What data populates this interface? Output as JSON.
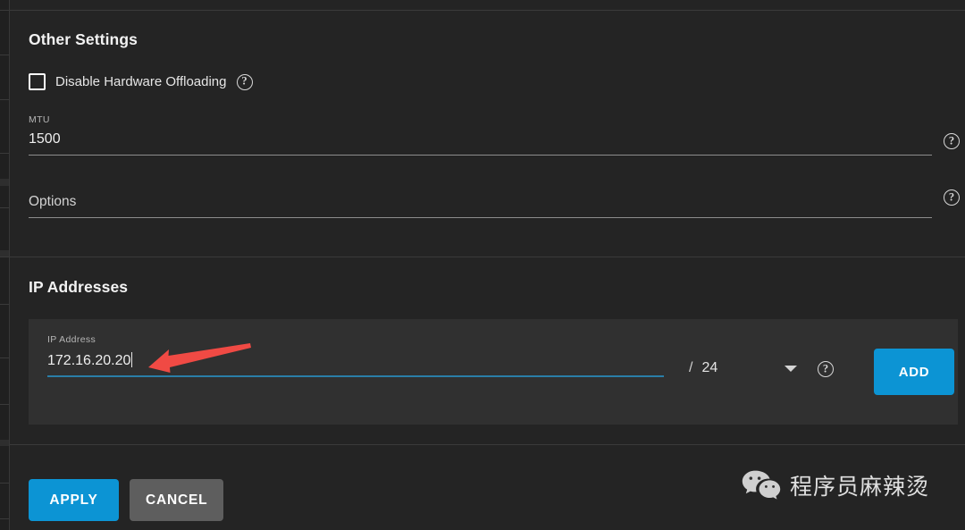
{
  "colors": {
    "page_bg": "#242424",
    "card_bg": "#303030",
    "accent_blue": "#0c94d4",
    "focus_underline": "#2a7ea8",
    "annotation_red": "#f04a44",
    "text_primary": "#eeeeee",
    "text_muted": "#b6b6b6",
    "divider": "#3a3a3a",
    "cancel_gray": "#5e5e5e"
  },
  "other_settings": {
    "title": "Other Settings",
    "checkbox": {
      "label": "Disable Hardware Offloading",
      "checked": false,
      "help_icon": "help-circle-icon"
    },
    "mtu": {
      "label": "MTU",
      "value": "1500",
      "help_icon": "help-circle-icon"
    },
    "options": {
      "label": "",
      "value": "",
      "placeholder": "Options",
      "help_icon": "help-circle-icon"
    }
  },
  "ip_addresses": {
    "title": "IP Addresses",
    "row": {
      "ip_label": "IP Address",
      "ip_value": "172.16.20.20",
      "ip_focused": true,
      "separator": "/",
      "prefix_value": "24",
      "prefix_caret_icon": "chevron-down-icon",
      "help_icon": "help-circle-icon",
      "add_label": "ADD"
    }
  },
  "footer": {
    "apply_label": "APPLY",
    "cancel_label": "CANCEL"
  },
  "watermark": {
    "icon": "wechat-icon",
    "text": "程序员麻辣烫"
  },
  "annotation": {
    "type": "arrow-left",
    "color": "#f04a44"
  }
}
